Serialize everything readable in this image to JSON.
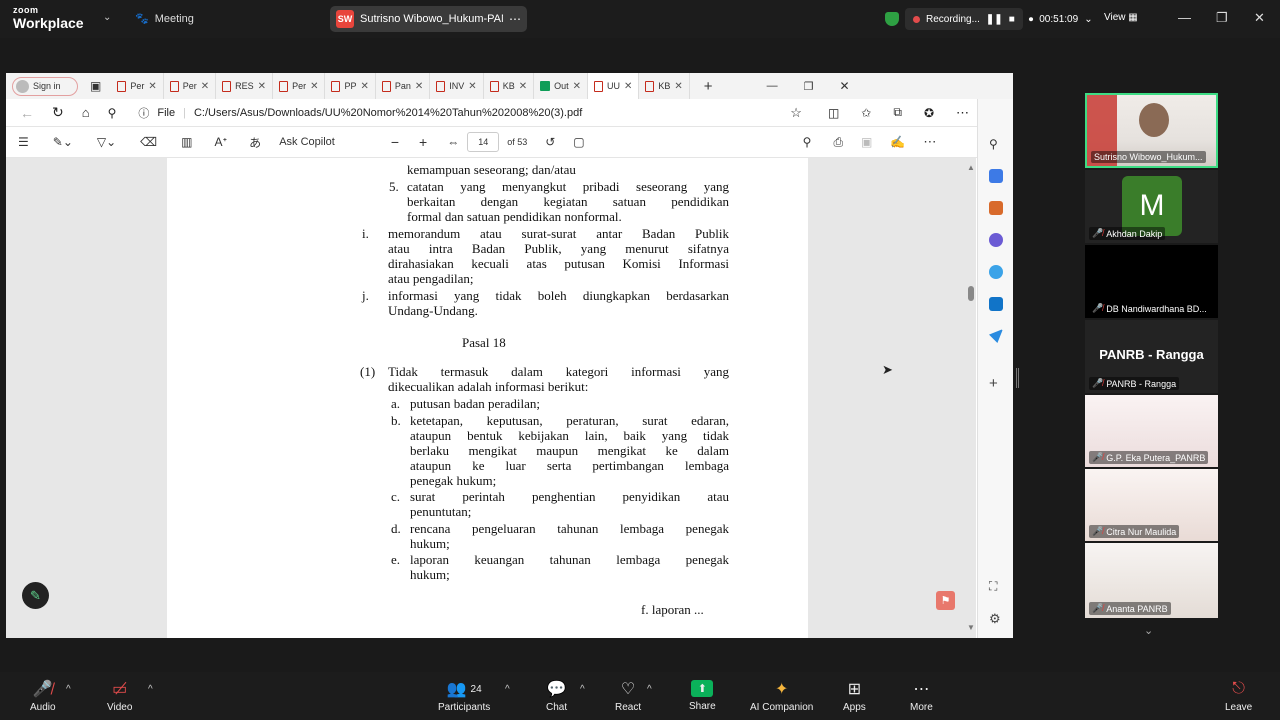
{
  "app": {
    "logo_line1": "zoom",
    "logo_line2": "Workplace",
    "meeting_label": "Meeting"
  },
  "share": {
    "initials": "SW",
    "name": "Sutrisno Wibowo_Hukum-PANRB"
  },
  "recording": {
    "label": "Recording...",
    "timer": "00:51:09"
  },
  "view_label": "View",
  "browser": {
    "signin": "Sign in",
    "tabs": [
      "Per",
      "Per",
      "RES",
      "Per",
      "PP",
      "Pan",
      "INV",
      "KB",
      "Out",
      "UU",
      "KB"
    ],
    "address_label": "File",
    "url": "C:/Users/Asus/Downloads/UU%20Nomor%2014%20Tahun%202008%20(3).pdf",
    "ask_copilot": "Ask Copilot",
    "page_num": "14",
    "page_total": "of 53"
  },
  "pdf": {
    "partial": "kemampuan seseorang; dan/atau",
    "item5_num": "5.",
    "item5": [
      "catatan yang menyangkut pribadi seseorang yang",
      "berkaitan dengan kegiatan satuan pendidikan",
      "formal dan satuan pendidikan nonformal."
    ],
    "item_i_num": "i.",
    "item_i": [
      "memorandum atau surat-surat antar Badan Publik",
      "atau intra Badan Publik, yang menurut sifatnya",
      "dirahasiakan kecuali atas putusan Komisi Informasi",
      "atau pengadilan;"
    ],
    "item_j_num": "j.",
    "item_j": [
      "informasi yang tidak boleh diungkapkan berdasarkan",
      "Undang-Undang."
    ],
    "pasal": "Pasal 18",
    "p1_num": "(1)",
    "p1": [
      "Tidak termasuk dalam kategori informasi yang",
      "dikecualikan adalah informasi berikut:"
    ],
    "a_num": "a.",
    "a": "putusan badan peradilan;",
    "b_num": "b.",
    "b": [
      "ketetapan, keputusan, peraturan, surat edaran,",
      "ataupun bentuk kebijakan lain, baik yang tidak",
      "berlaku mengikat maupun mengikat ke dalam",
      "ataupun ke luar serta pertimbangan lembaga",
      "penegak hukum;"
    ],
    "c_num": "c.",
    "c": [
      "surat perintah penghentian penyidikan atau",
      "penuntutan;"
    ],
    "d_num": "d.",
    "d": [
      "rencana pengeluaran tahunan lembaga penegak",
      "hukum;"
    ],
    "e_num": "e.",
    "e": [
      "laporan keuangan tahunan lembaga penegak",
      "hukum;"
    ],
    "footer": "f. laporan ..."
  },
  "participants": [
    {
      "name": "Sutrisno Wibowo_Hukum...",
      "type": "video"
    },
    {
      "name": "Akhdan Dakip",
      "avatar_letter": "M",
      "type": "avatar"
    },
    {
      "name": "DB Nandiwardhana BD...",
      "type": "black"
    },
    {
      "name": "PANRB - Rangga",
      "big_name": "PANRB - Rangga",
      "type": "name"
    },
    {
      "name": "G.P. Eka Putera_PANRB",
      "type": "bg"
    },
    {
      "name": "Citra Nur Maulida",
      "type": "bg"
    },
    {
      "name": "Ananta PANRB",
      "type": "bg"
    }
  ],
  "bottom": {
    "audio": "Audio",
    "video": "Video",
    "participants": "Participants",
    "participants_count": "24",
    "chat": "Chat",
    "react": "React",
    "share": "Share",
    "ai": "AI Companion",
    "apps": "Apps",
    "more": "More",
    "leave": "Leave"
  },
  "colors": {
    "share_green": "#0bb15a",
    "active_border": "#3ddc84",
    "recording_red": "#e34c4c"
  }
}
